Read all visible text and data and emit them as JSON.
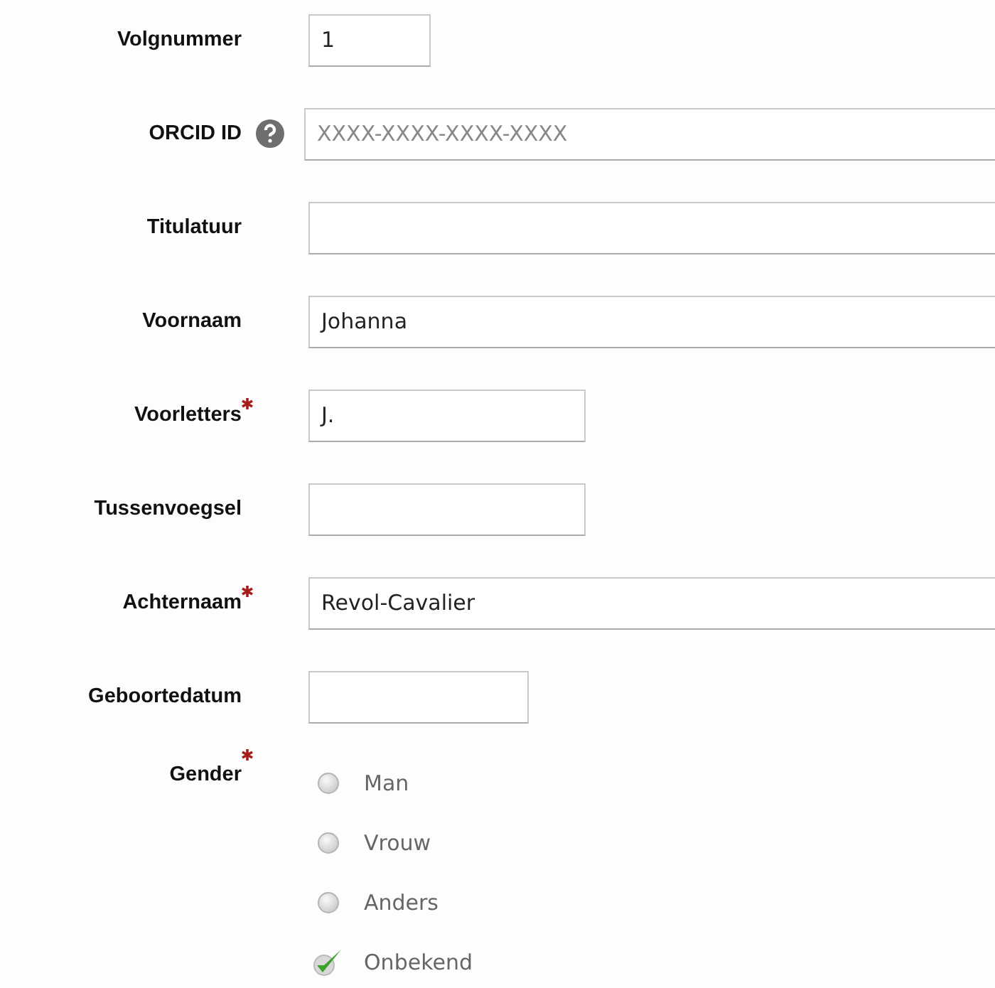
{
  "fields": [
    {
      "label": "Volgnummer",
      "value": "1",
      "kind": "short",
      "required": false
    },
    {
      "label": "ORCID ID",
      "placeholder": "XXXX-XXXX-XXXX-XXXX",
      "kind": "wide",
      "required": false,
      "help": true
    },
    {
      "label": "Titulatuur",
      "kind": "wide",
      "required": false
    },
    {
      "label": "Voornaam",
      "value": "Johanna",
      "kind": "wide",
      "required": false
    },
    {
      "label": "Voorletters",
      "value": "J.",
      "kind": "medium",
      "required": true
    },
    {
      "label": "Tussenvoegsel",
      "kind": "medium",
      "required": false
    },
    {
      "label": "Achternaam",
      "value": "Revol-Cavalier",
      "kind": "wide",
      "required": true
    },
    {
      "label": "Geboortedatum",
      "kind": "small",
      "required": false
    }
  ],
  "gender": {
    "label": "Gender",
    "required": true,
    "options": [
      {
        "label": "Man",
        "selected": false
      },
      {
        "label": "Vrouw",
        "selected": false
      },
      {
        "label": "Anders",
        "selected": false
      },
      {
        "label": "Onbekend",
        "selected": true
      }
    ]
  }
}
